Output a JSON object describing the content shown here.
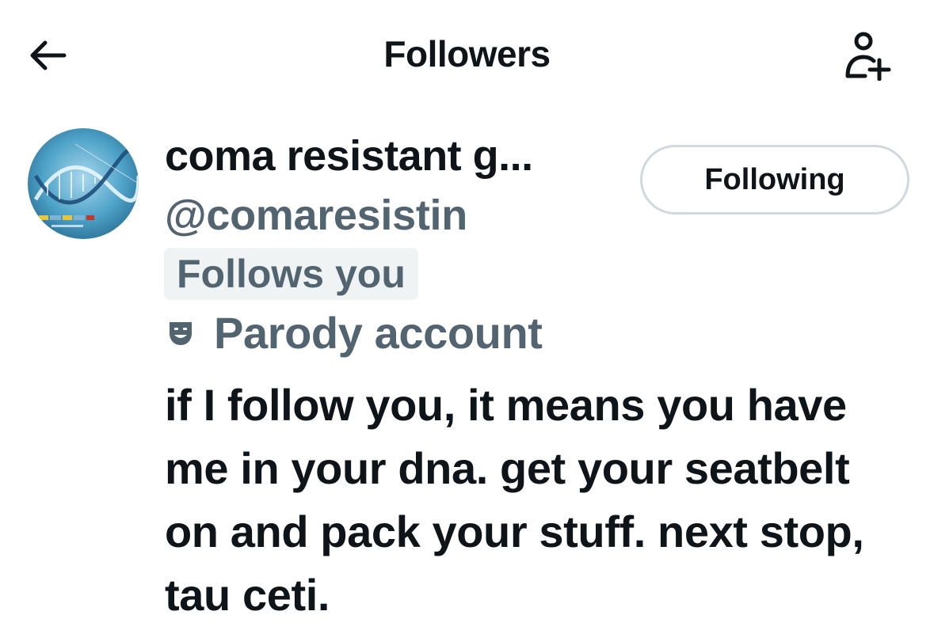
{
  "header": {
    "title": "Followers",
    "back_icon": "arrow-left-icon",
    "add_user_icon": "person-add-icon"
  },
  "user": {
    "avatar_icon": "dna-helix-avatar",
    "display_name": "coma resistant g...",
    "handle": "@comaresistin",
    "follows_you_label": "Follows you",
    "parody_label": "Parody account",
    "parody_icon": "theater-mask-icon",
    "bio": "if I follow you, it means you have me in your dna. get your seatbelt on and pack your stuff. next stop, tau ceti.",
    "following_button_label": "Following"
  },
  "colors": {
    "text_primary": "#0f1419",
    "text_secondary": "#536471",
    "badge_background": "#eff3f4",
    "button_border": "#cfd9de"
  }
}
